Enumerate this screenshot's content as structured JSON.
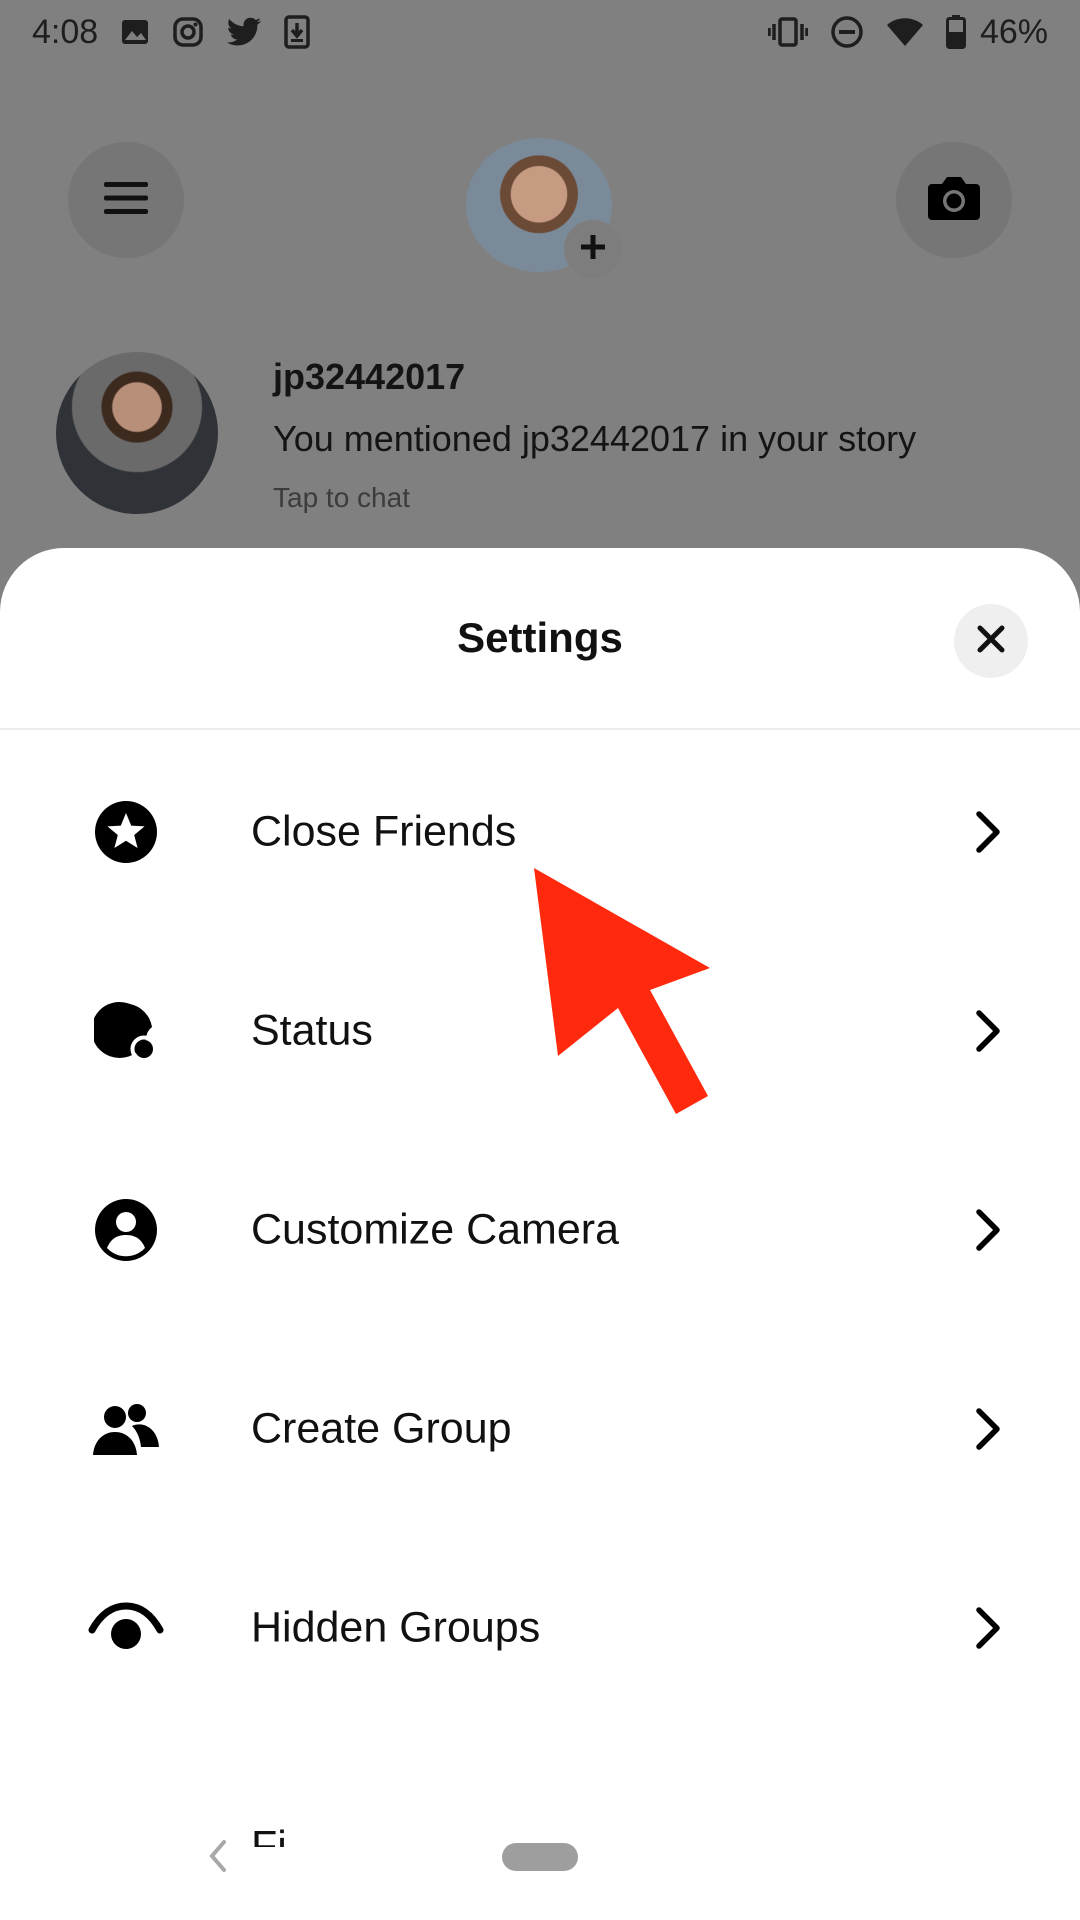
{
  "status_bar": {
    "time": "4:08",
    "battery": "46%",
    "left_icons": [
      "image-icon",
      "instagram-icon",
      "twitter-icon",
      "download-icon"
    ],
    "right_icons": [
      "vibrate-icon",
      "do-not-disturb-icon",
      "wifi-icon",
      "battery-icon"
    ]
  },
  "header": {
    "menu_icon": "hamburger-menu-icon",
    "camera_icon": "camera-icon",
    "avatar_badge_icon": "plus-icon"
  },
  "chat": {
    "name": "jp32442017",
    "message": "You mentioned jp32442017 in your story",
    "subtitle": "Tap to chat"
  },
  "sheet": {
    "title": "Settings",
    "close_icon": "close-icon",
    "items": [
      {
        "label": "Close Friends",
        "icon": "star-circle-icon"
      },
      {
        "label": "Status",
        "icon": "status-icon"
      },
      {
        "label": "Customize Camera",
        "icon": "person-circle-icon"
      },
      {
        "label": "Create Group",
        "icon": "group-icon"
      },
      {
        "label": "Hidden Groups",
        "icon": "eye-icon"
      },
      {
        "label": "Fi",
        "icon": ""
      }
    ]
  },
  "colors": {
    "overlay_gray": "#808080",
    "sheet_bg": "#ffffff",
    "annotation_red": "#ff2a0e"
  }
}
